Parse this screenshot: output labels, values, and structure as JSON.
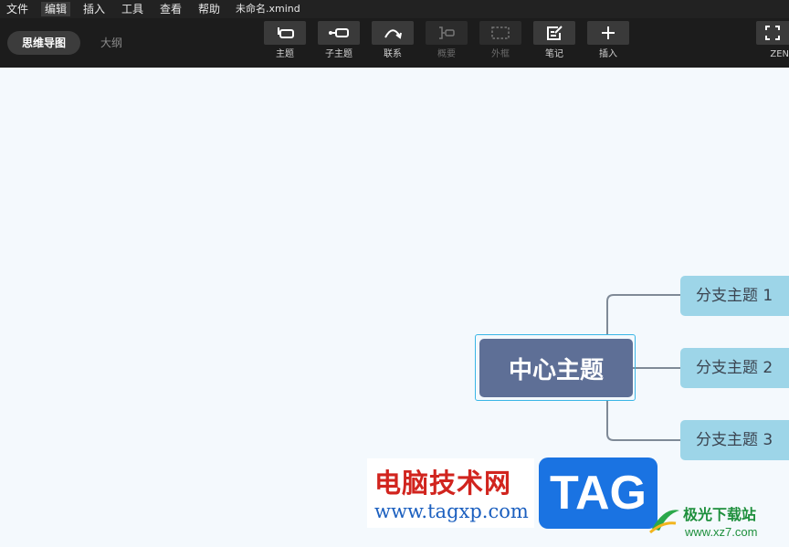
{
  "menu": {
    "items": [
      "文件",
      "编辑",
      "插入",
      "工具",
      "查看",
      "帮助"
    ],
    "filename": "未命名.xmind"
  },
  "view_tabs": {
    "mindmap": "思维导图",
    "outline": "大纲"
  },
  "tools": {
    "topic": "主题",
    "subtopic": "子主题",
    "relationship": "联系",
    "summary": "概要",
    "boundary": "外框",
    "note": "笔记",
    "insert": "插入",
    "zen": "ZEN"
  },
  "mindmap": {
    "central": "中心主题",
    "branches": [
      "分支主题 1",
      "分支主题 2",
      "分支主题 3"
    ]
  },
  "watermark": {
    "title": "电脑技术网",
    "url": "www.tagxp.com",
    "tag": "TAG",
    "site_name": "极光下载站",
    "site_url": "www.xz7.com"
  },
  "colors": {
    "central_fill": "#5e6f96",
    "branch_fill": "#9dd5e8",
    "connector": "#7f8a97",
    "selection": "#39b6e6",
    "canvas": "#f4f9fd"
  }
}
